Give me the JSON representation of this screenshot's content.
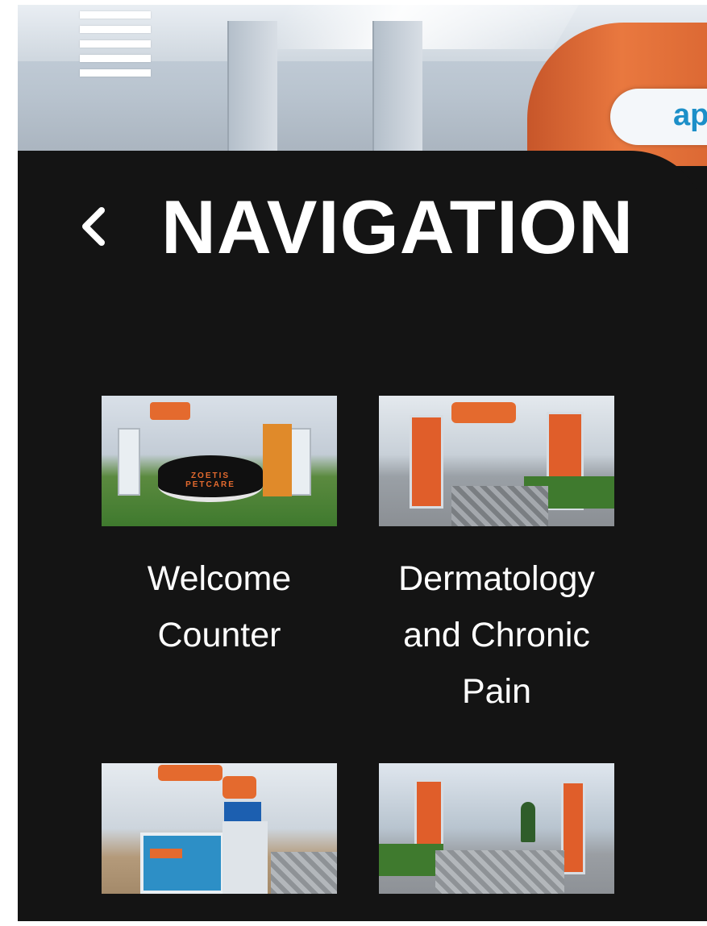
{
  "menu": {
    "icon": "hamburger-menu-icon"
  },
  "scene": {
    "sign_text": "ap"
  },
  "navigation": {
    "back_icon": "chevron-left-icon",
    "title": "NAVIGATION",
    "items": [
      {
        "label_line1": "Welcome",
        "label_line2": "Counter",
        "label_line3": "",
        "booth_text": "ZOETIS PETCARE"
      },
      {
        "label_line1": "Dermatology",
        "label_line2": "and Chronic",
        "label_line3": "Pain"
      },
      {
        "label_line1": "",
        "label_line2": "",
        "label_line3": ""
      },
      {
        "label_line1": "",
        "label_line2": "",
        "label_line3": ""
      }
    ]
  },
  "colors": {
    "drawer_bg": "#141414",
    "accent_orange": "#e46a2e",
    "text": "#ffffff"
  }
}
